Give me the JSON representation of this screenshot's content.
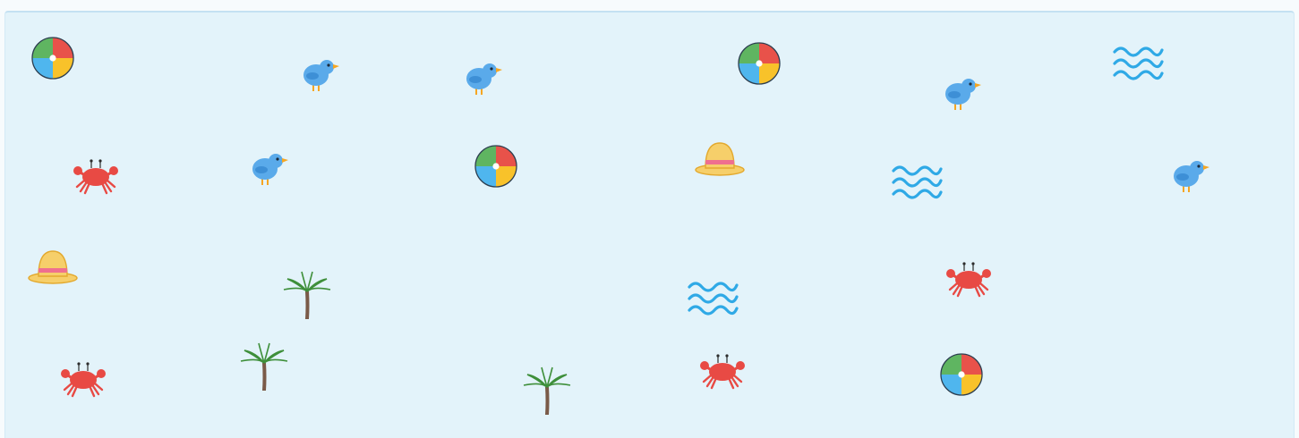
{
  "board": {
    "sprites": [
      {
        "kind": "beach-ball-icon"
      },
      {
        "kind": "bird-icon"
      },
      {
        "kind": "bird-icon"
      },
      {
        "kind": "beach-ball-icon"
      },
      {
        "kind": "bird-icon"
      },
      {
        "kind": "waves-icon"
      },
      {
        "kind": "crab-icon"
      },
      {
        "kind": "bird-icon"
      },
      {
        "kind": "beach-ball-icon"
      },
      {
        "kind": "sun-hat-icon"
      },
      {
        "kind": "waves-icon"
      },
      {
        "kind": "bird-icon"
      },
      {
        "kind": "sun-hat-icon"
      },
      {
        "kind": "palm-tree-icon"
      },
      {
        "kind": "waves-icon"
      },
      {
        "kind": "crab-icon"
      },
      {
        "kind": "crab-icon"
      },
      {
        "kind": "palm-tree-icon"
      },
      {
        "kind": "palm-tree-icon"
      },
      {
        "kind": "crab-icon"
      },
      {
        "kind": "beach-ball-icon"
      }
    ]
  },
  "colors": {
    "background": "#e3f3fa",
    "ball_red": "#e8524a",
    "ball_green": "#5fb561",
    "ball_blue": "#4fb6ee",
    "ball_yellow": "#f8c22a",
    "bird": "#5aaaea",
    "beak": "#f5a623",
    "crab": "#e84a44",
    "hat": "#f6cf6a",
    "hat_band": "#ef6f8f",
    "waves": "#2fa9e6",
    "palm_leaf": "#3e8f3a",
    "palm_trunk": "#7a5a48"
  }
}
